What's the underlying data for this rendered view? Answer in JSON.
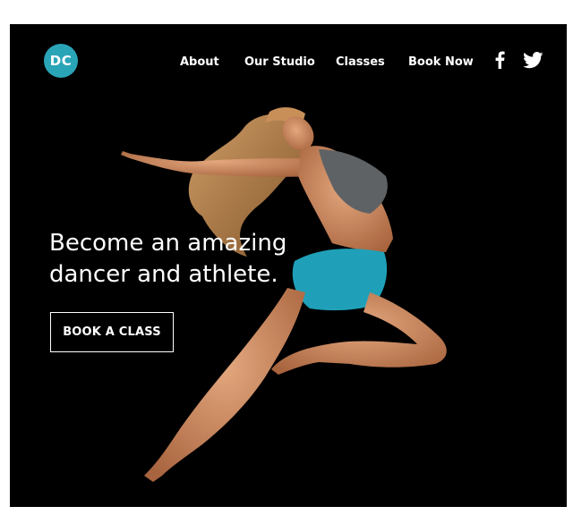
{
  "brand": {
    "logo_text": "DC",
    "logo_color": "#2aa5b8"
  },
  "nav": {
    "items": [
      {
        "label": "About"
      },
      {
        "label": "Our Studio"
      },
      {
        "label": "Classes"
      },
      {
        "label": "Book Now"
      }
    ]
  },
  "social": {
    "icons": [
      "facebook-icon",
      "twitter-icon"
    ]
  },
  "hero": {
    "headline_line1": "Become an amazing",
    "headline_line2": "dancer and athlete.",
    "cta_label": "BOOK A CLASS",
    "background_color": "#000000",
    "outfit_color": "#1fa0b8"
  }
}
